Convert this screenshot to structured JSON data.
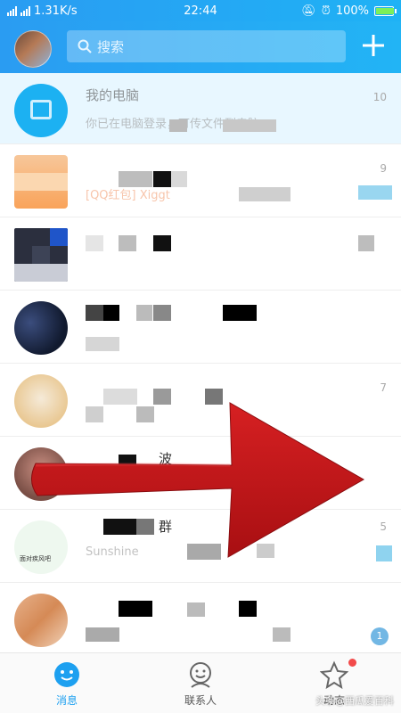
{
  "status_bar": {
    "network_label": "2G 4G 4G",
    "speed": "1.31K/s",
    "time": "22:44",
    "battery": "100%"
  },
  "header": {
    "search_placeholder": "搜索",
    "add_icon": "plus-icon"
  },
  "conversations": [
    {
      "name": "我的电脑",
      "preview": "你已在电脑登录，可传文件到电脑。",
      "time": "10"
    },
    {
      "name": "",
      "preview": "[QQ红包] Xiggt",
      "time": "9"
    },
    {
      "name": "",
      "preview": "",
      "time": ""
    },
    {
      "name": "",
      "preview": "",
      "time": ""
    },
    {
      "name": "",
      "preview": "",
      "time": "7"
    },
    {
      "name": "波",
      "preview": "",
      "time": ""
    },
    {
      "name": "群",
      "preview": "Sunshine",
      "time": "5"
    },
    {
      "name": "",
      "preview": "",
      "time": ""
    }
  ],
  "badges": {
    "unread": "1"
  },
  "tabbar": {
    "messages": "消息",
    "contacts": "联系人",
    "dynamic": "动态"
  },
  "watermark": "头条@西瓜爱百科",
  "colors": {
    "header_blue": "#2a9cf2",
    "arrow_red": "#c0181b",
    "active_tab": "#1da0f0"
  }
}
